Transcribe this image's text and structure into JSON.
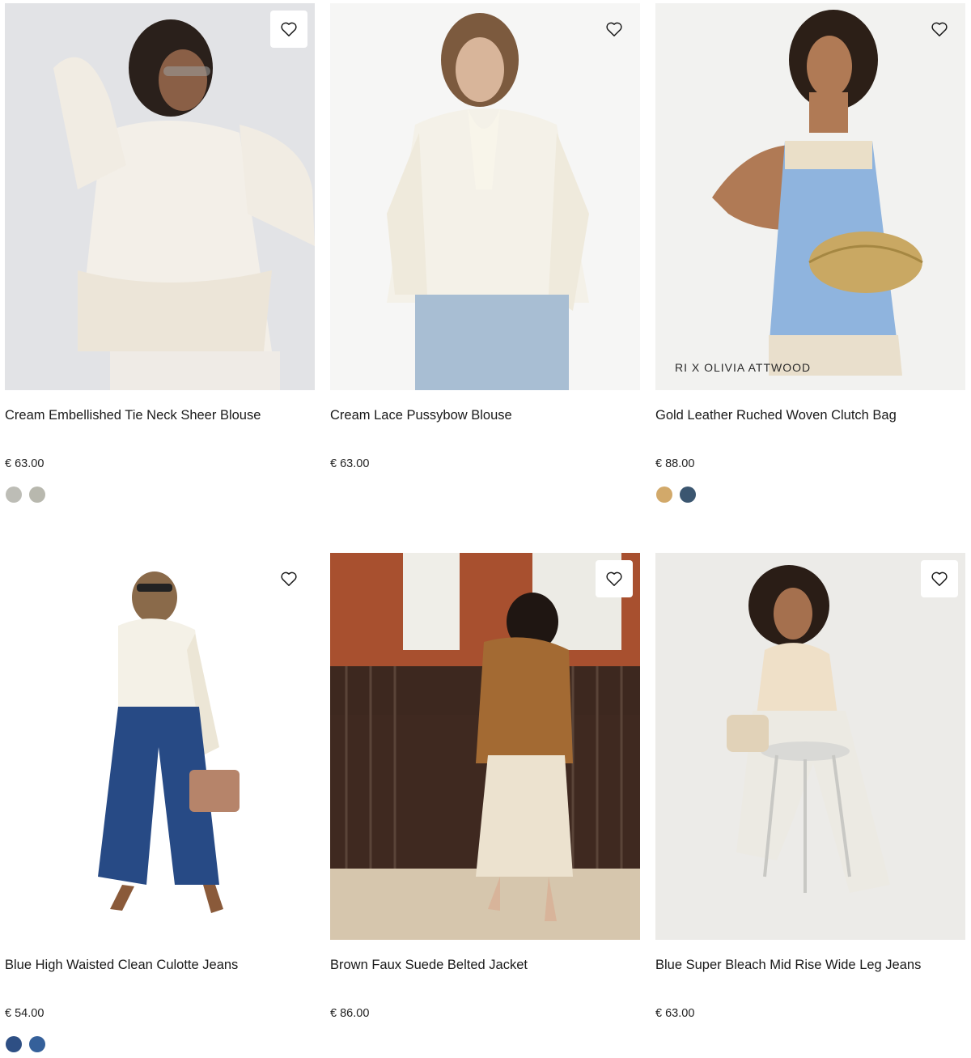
{
  "products": [
    {
      "title": "Cream Embellished Tie Neck Sheer Blouse",
      "price": "€ 63.00",
      "badge": "",
      "wishlist_icon": "heart-outline-icon",
      "swatches": [
        "#bdbdb6",
        "#b8b8ae"
      ]
    },
    {
      "title": "Cream Lace Pussybow Blouse",
      "price": "€ 63.00",
      "badge": "",
      "wishlist_icon": "heart-outline-icon",
      "swatches": []
    },
    {
      "title": "Gold Leather Ruched Woven Clutch Bag",
      "price": "€ 88.00",
      "badge": "RI X OLIVIA ATTWOOD",
      "wishlist_icon": "heart-outline-icon",
      "swatches": [
        "#d2a96a",
        "#3b5670"
      ]
    },
    {
      "title": "Blue High Waisted Clean Culotte Jeans",
      "price": "€ 54.00",
      "badge": "",
      "wishlist_icon": "heart-outline-icon",
      "swatches": [
        "#2e4f84",
        "#35609a"
      ]
    },
    {
      "title": "Brown Faux Suede Belted Jacket",
      "price": "€ 86.00",
      "badge": "",
      "wishlist_icon": "heart-outline-icon",
      "swatches": []
    },
    {
      "title": "Blue Super Bleach Mid Rise Wide Leg Jeans",
      "price": "€ 63.00",
      "badge": "",
      "wishlist_icon": "heart-outline-icon",
      "swatches": []
    }
  ]
}
